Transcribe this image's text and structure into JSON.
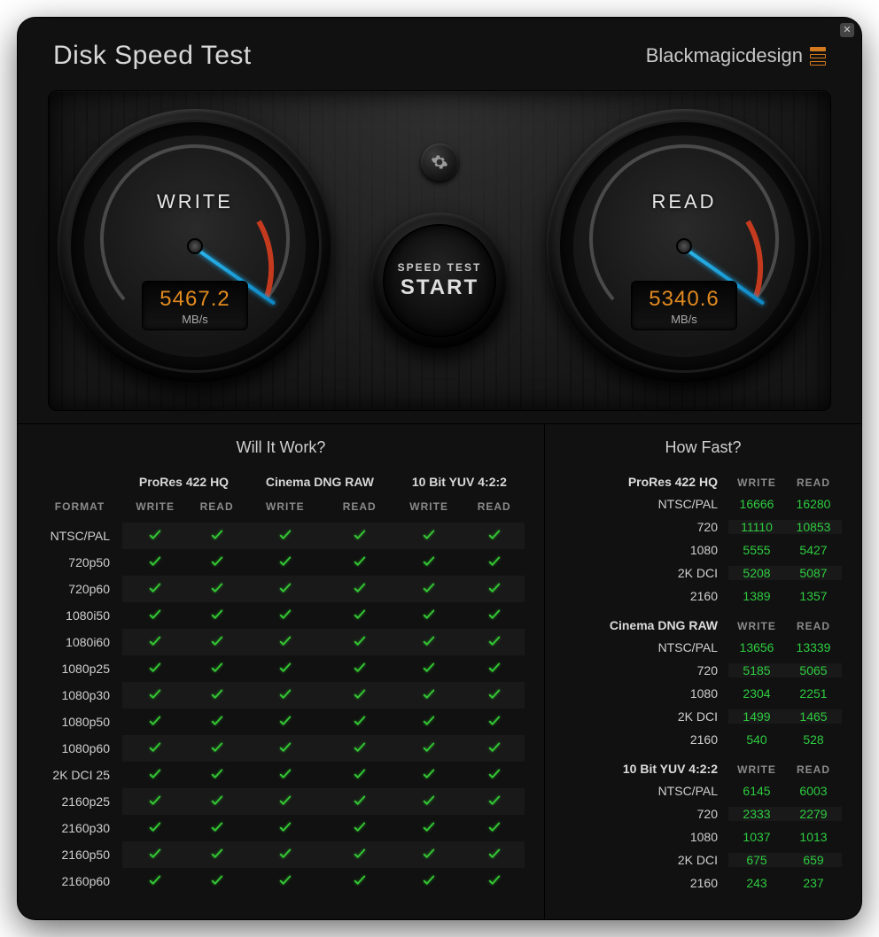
{
  "app_title": "Disk Speed Test",
  "brand": "Blackmagicdesign",
  "settings_icon": "gear-icon",
  "start": {
    "line1": "SPEED TEST",
    "line2": "START"
  },
  "gauges": {
    "write": {
      "label": "WRITE",
      "value": "5467.2",
      "unit": "MB/s",
      "needle_deg": 35
    },
    "read": {
      "label": "READ",
      "value": "5340.6",
      "unit": "MB/s",
      "needle_deg": 35
    }
  },
  "will_it_work": {
    "title": "Will It Work?",
    "format_header": "FORMAT",
    "codec_groups": [
      "ProRes 422 HQ",
      "Cinema DNG RAW",
      "10 Bit YUV 4:2:2"
    ],
    "subheaders": [
      "WRITE",
      "READ"
    ],
    "rows": [
      {
        "f": "NTSC/PAL",
        "v": [
          1,
          1,
          1,
          1,
          1,
          1
        ]
      },
      {
        "f": "720p50",
        "v": [
          1,
          1,
          1,
          1,
          1,
          1
        ]
      },
      {
        "f": "720p60",
        "v": [
          1,
          1,
          1,
          1,
          1,
          1
        ]
      },
      {
        "f": "1080i50",
        "v": [
          1,
          1,
          1,
          1,
          1,
          1
        ]
      },
      {
        "f": "1080i60",
        "v": [
          1,
          1,
          1,
          1,
          1,
          1
        ]
      },
      {
        "f": "1080p25",
        "v": [
          1,
          1,
          1,
          1,
          1,
          1
        ]
      },
      {
        "f": "1080p30",
        "v": [
          1,
          1,
          1,
          1,
          1,
          1
        ]
      },
      {
        "f": "1080p50",
        "v": [
          1,
          1,
          1,
          1,
          1,
          1
        ]
      },
      {
        "f": "1080p60",
        "v": [
          1,
          1,
          1,
          1,
          1,
          1
        ]
      },
      {
        "f": "2K DCI 25",
        "v": [
          1,
          1,
          1,
          1,
          1,
          1
        ]
      },
      {
        "f": "2160p25",
        "v": [
          1,
          1,
          1,
          1,
          1,
          1
        ]
      },
      {
        "f": "2160p30",
        "v": [
          1,
          1,
          1,
          1,
          1,
          1
        ]
      },
      {
        "f": "2160p50",
        "v": [
          1,
          1,
          1,
          1,
          1,
          1
        ]
      },
      {
        "f": "2160p60",
        "v": [
          1,
          1,
          1,
          1,
          1,
          1
        ]
      }
    ]
  },
  "how_fast": {
    "title": "How Fast?",
    "subheaders": [
      "WRITE",
      "READ"
    ],
    "groups": [
      {
        "name": "ProRes 422 HQ",
        "rows": [
          {
            "f": "NTSC/PAL",
            "w": "16666",
            "r": "16280"
          },
          {
            "f": "720",
            "w": "11110",
            "r": "10853"
          },
          {
            "f": "1080",
            "w": "5555",
            "r": "5427"
          },
          {
            "f": "2K DCI",
            "w": "5208",
            "r": "5087"
          },
          {
            "f": "2160",
            "w": "1389",
            "r": "1357"
          }
        ]
      },
      {
        "name": "Cinema DNG RAW",
        "rows": [
          {
            "f": "NTSC/PAL",
            "w": "13656",
            "r": "13339"
          },
          {
            "f": "720",
            "w": "5185",
            "r": "5065"
          },
          {
            "f": "1080",
            "w": "2304",
            "r": "2251"
          },
          {
            "f": "2K DCI",
            "w": "1499",
            "r": "1465"
          },
          {
            "f": "2160",
            "w": "540",
            "r": "528"
          }
        ]
      },
      {
        "name": "10 Bit YUV 4:2:2",
        "rows": [
          {
            "f": "NTSC/PAL",
            "w": "6145",
            "r": "6003"
          },
          {
            "f": "720",
            "w": "2333",
            "r": "2279"
          },
          {
            "f": "1080",
            "w": "1037",
            "r": "1013"
          },
          {
            "f": "2K DCI",
            "w": "675",
            "r": "659"
          },
          {
            "f": "2160",
            "w": "243",
            "r": "237"
          }
        ]
      }
    ]
  }
}
